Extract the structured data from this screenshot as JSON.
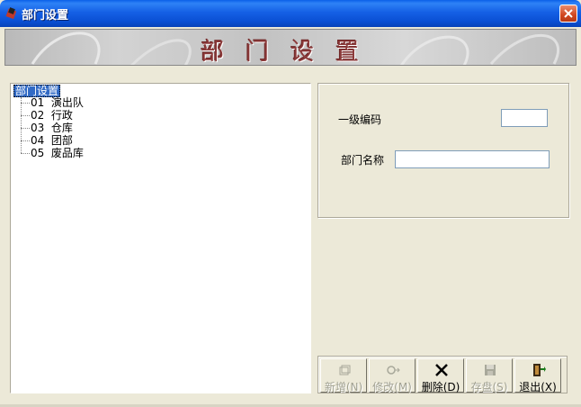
{
  "window": {
    "title": "部门设置"
  },
  "banner": {
    "title": "部门设置"
  },
  "tree": {
    "root": "部门设置",
    "items": [
      {
        "label": "01  演出队"
      },
      {
        "label": "02  行政"
      },
      {
        "label": "03  仓库"
      },
      {
        "label": "04  团部"
      },
      {
        "label": "05  废品库"
      }
    ]
  },
  "form": {
    "level1_code_label": "一级编码",
    "level1_code_value": "",
    "dept_name_label": "部门名称",
    "dept_name_value": ""
  },
  "buttons": {
    "add": "新增(N)",
    "edit": "修改(M)",
    "delete": "删除(D)",
    "save": "存盘(S)",
    "exit": "退出(X)"
  },
  "colors": {
    "title_bar": "#0A5FE8",
    "selection": "#316AC5",
    "banner_text": "#8B3A3A"
  }
}
